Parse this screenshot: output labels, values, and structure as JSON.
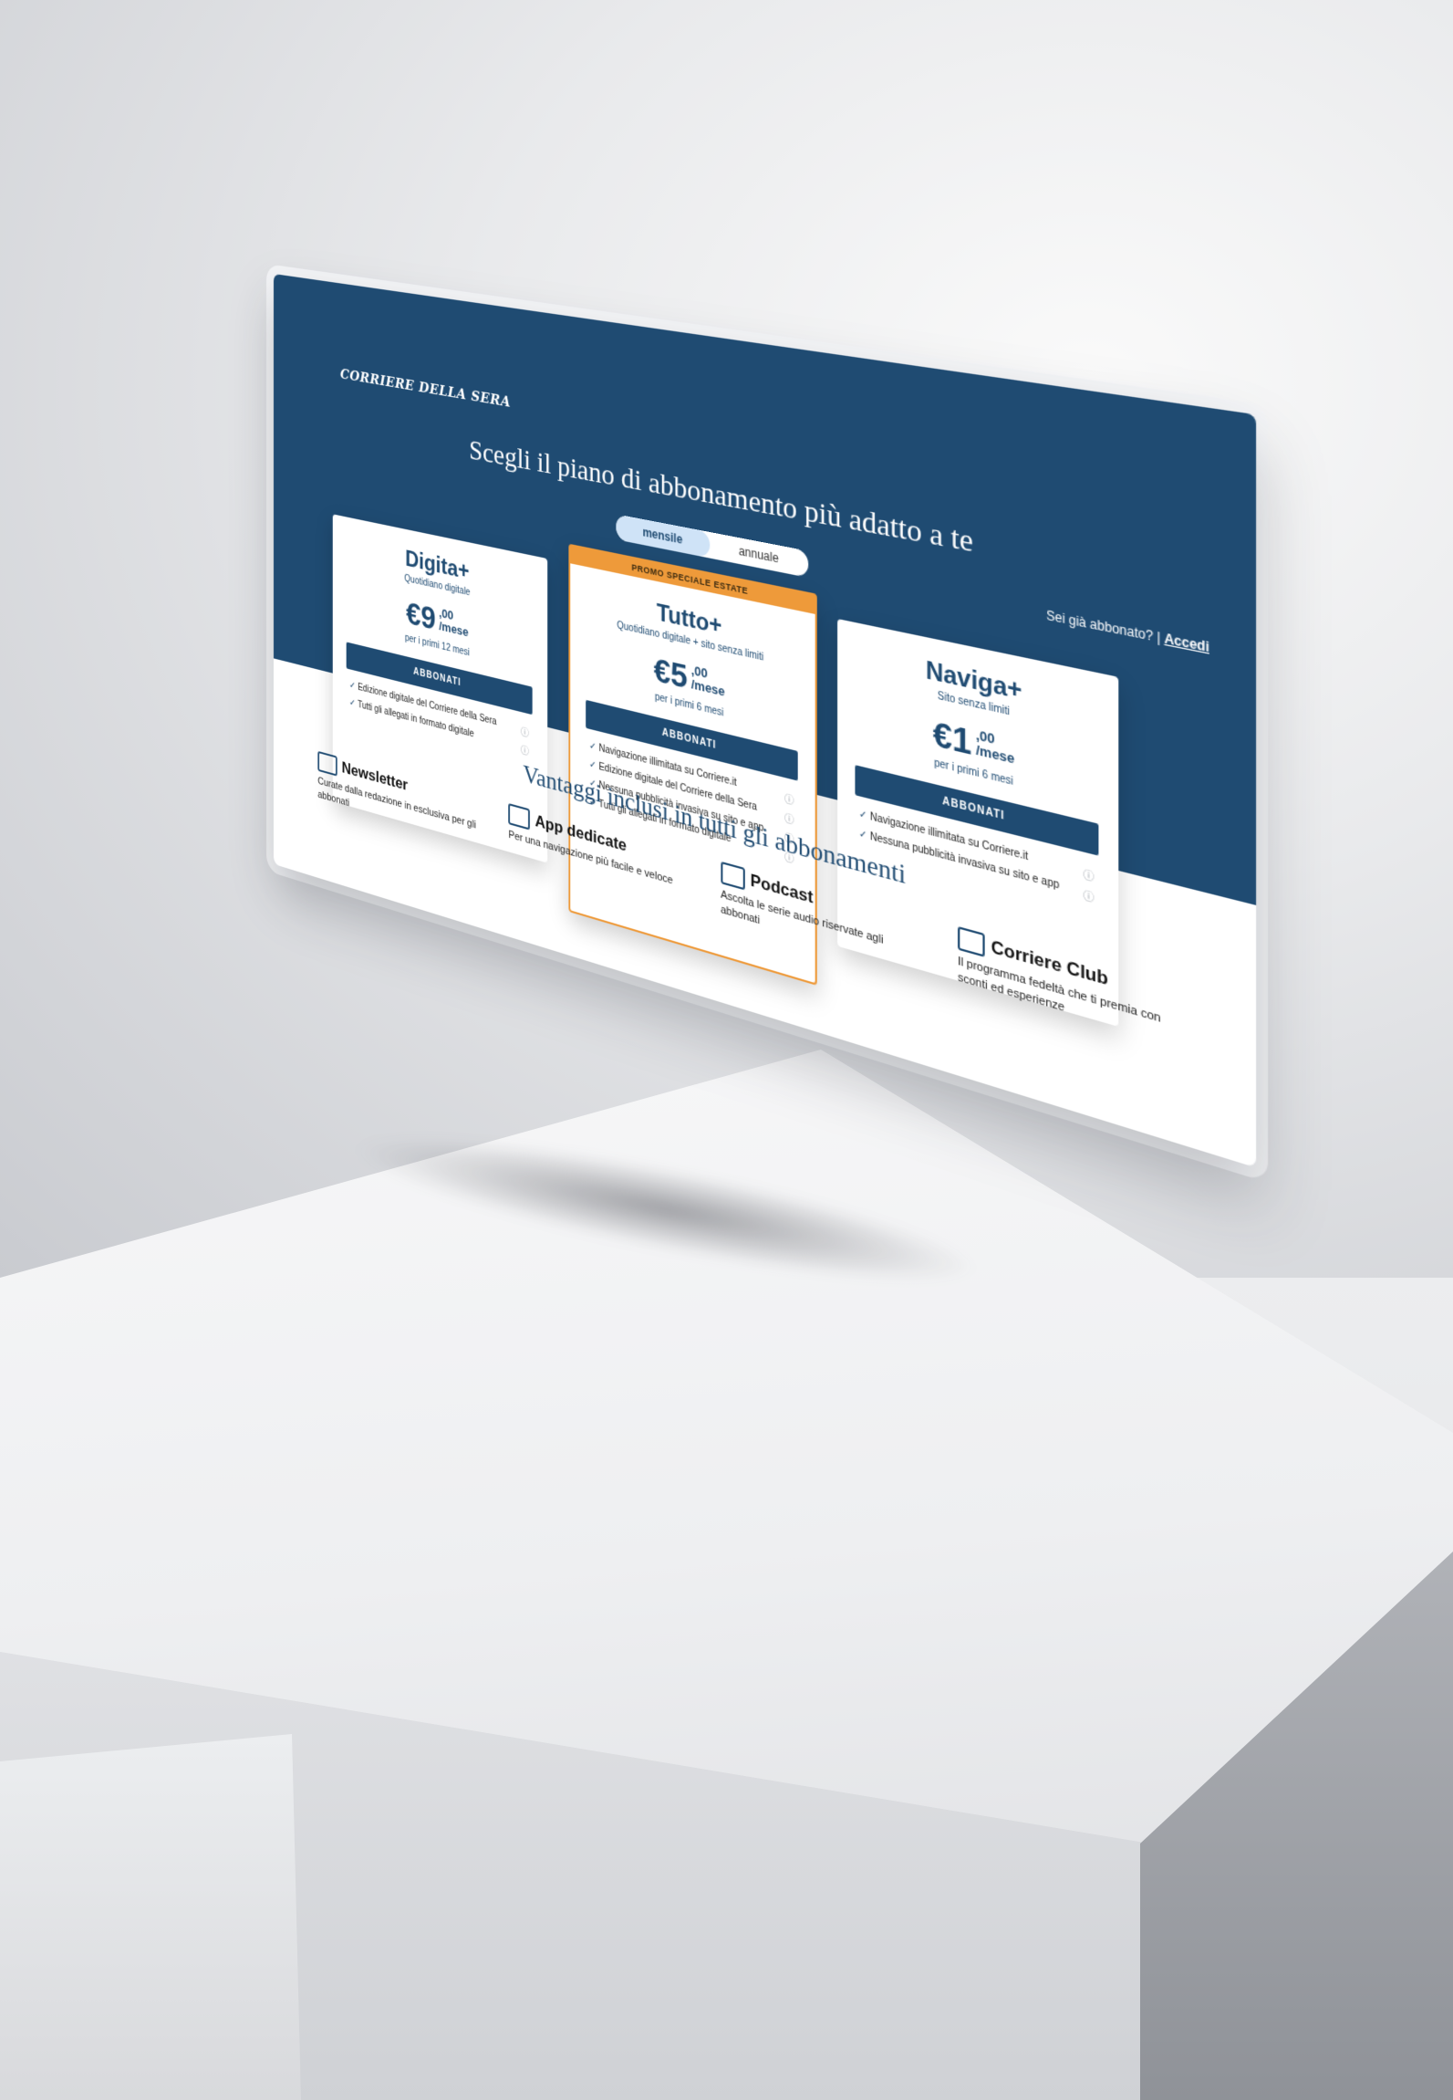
{
  "brand": {
    "logo_text": "CORRIERE DELLA SERA",
    "primary_color": "#1f4b72",
    "accent_color": "#ee9a3a"
  },
  "header": {
    "headline": "Scegli il piano di abbonamento più adatto a te",
    "login_prompt": "Sei già abbonato? |",
    "login_link": "Accedi"
  },
  "billing_toggle": {
    "options": [
      "mensile",
      "annuale"
    ],
    "selected": "mensile"
  },
  "plans": [
    {
      "name": "Digita+",
      "subtitle": "Quotidiano digitale",
      "price_main": "€9",
      "price_decimal": ",00",
      "price_unit": "/mese",
      "period": "per i primi 12 mesi",
      "cta": "ABBONATI",
      "features": [
        "Edizione digitale del Corriere della Sera",
        "Tutti gli allegati in formato digitale"
      ],
      "promo": ""
    },
    {
      "name": "Tutto+",
      "subtitle": "Quotidiano digitale + sito senza limiti",
      "price_main": "€5",
      "price_decimal": ",00",
      "price_unit": "/mese",
      "period": "per i primi 6 mesi",
      "cta": "ABBONATI",
      "features": [
        "Navigazione illimitata su Corriere.it",
        "Edizione digitale del Corriere della Sera",
        "Nessuna pubblicità invasiva su sito e app",
        "Tutti gli allegati in formato digitale"
      ],
      "promo": "PROMO SPECIALE ESTATE"
    },
    {
      "name": "Naviga+",
      "subtitle": "Sito senza limiti",
      "price_main": "€1",
      "price_decimal": ",00",
      "price_unit": "/mese",
      "period": "per i primi 6 mesi",
      "cta": "ABBONATI",
      "features": [
        "Navigazione illimitata su Corriere.it",
        "Nessuna pubblicità invasiva su sito e app"
      ],
      "promo": ""
    }
  ],
  "benefits": {
    "title": "Vantaggi inclusi in tutti gli abbonamenti",
    "items": [
      {
        "icon": "envelope-icon",
        "title": "Newsletter",
        "desc": "Curate dalla redazione in esclusiva per gli abbonati"
      },
      {
        "icon": "devices-icon",
        "title": "App dedicate",
        "desc": "Per una navigazione più facile e veloce"
      },
      {
        "icon": "headphones-icon",
        "title": "Podcast",
        "desc": "Ascolta le serie audio riservate agli abbonati"
      },
      {
        "icon": "badge-icon",
        "title": "Corriere Club",
        "desc": "Il programma fedeltà che ti premia con sconti ed esperienze"
      }
    ]
  }
}
